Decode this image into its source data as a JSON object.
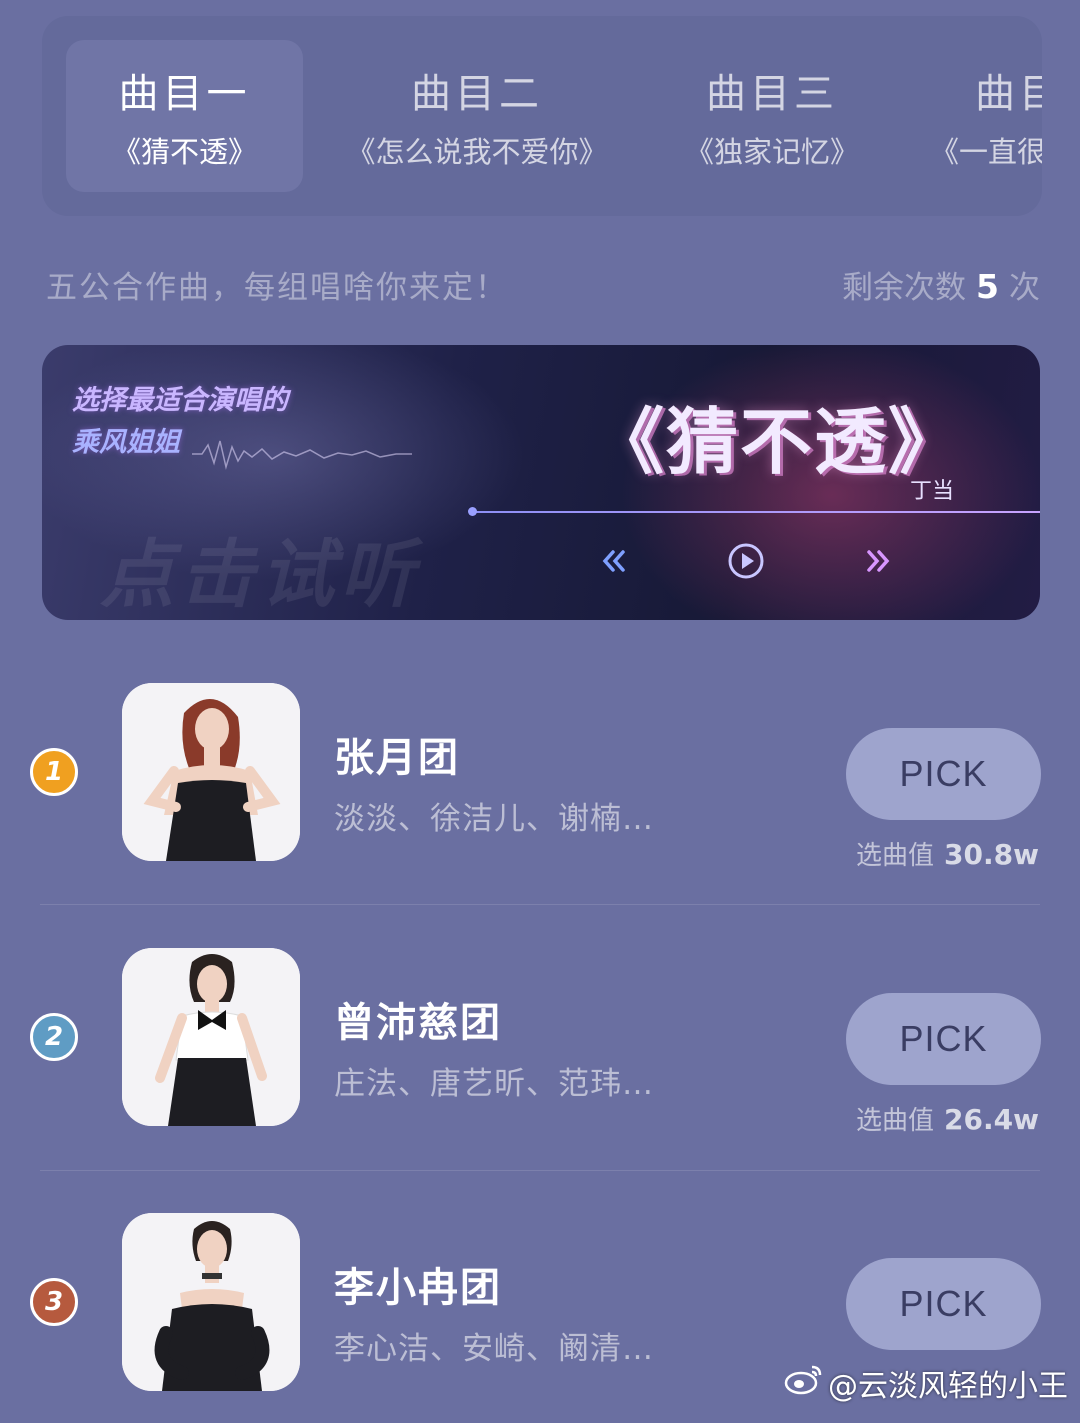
{
  "tabs": [
    {
      "title": "曲目一",
      "song": "《猜不透》",
      "active": true
    },
    {
      "title": "曲目二",
      "song": "《怎么说我不爱你》"
    },
    {
      "title": "曲目三",
      "song": "《独家记忆》"
    },
    {
      "title": "曲目",
      "song": "《一直很"
    }
  ],
  "info": {
    "subtitle": "五公合作曲，每组唱啥你来定！",
    "remaining_label": "剩余次数",
    "remaining_count": "5",
    "remaining_unit": "次"
  },
  "banner": {
    "tagline_line1": "选择最适合演唱的",
    "tagline_line2": "乘风姐姐",
    "song_title": "《猜不透》",
    "artist": "丁当",
    "listen_hint": "点击试听"
  },
  "groups": [
    {
      "rank": "1",
      "rank_color": "#f0a020",
      "name": "张月团",
      "members": "淡淡、徐洁儿、谢楠…",
      "pick_label": "PICK",
      "score_label": "选曲值",
      "score": "30.8w"
    },
    {
      "rank": "2",
      "rank_color": "#5f9cc4",
      "name": "曾沛慈团",
      "members": "庄法、唐艺昕、范玮…",
      "pick_label": "PICK",
      "score_label": "选曲值",
      "score": "26.4w"
    },
    {
      "rank": "3",
      "rank_color": "#b65a3e",
      "name": "李小冉团",
      "members": "李心洁、安崎、阚清…",
      "pick_label": "PICK"
    }
  ],
  "watermark": "@云淡风轻的小王",
  "icons": {
    "prev": "double-chevron-left-icon",
    "play": "play-circle-icon",
    "next": "double-chevron-right-icon",
    "watermark": "weibo-logo-icon"
  }
}
